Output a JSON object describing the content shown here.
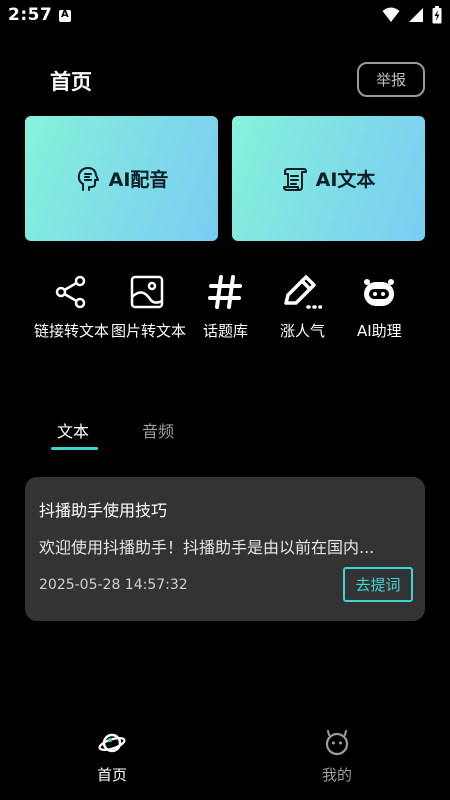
{
  "status": {
    "time": "2:57"
  },
  "header": {
    "title": "首页",
    "report_label": "举报"
  },
  "cards": {
    "left": {
      "label": "AI配音",
      "icon": "ai-voice-icon"
    },
    "right": {
      "label": "AI文本",
      "icon": "scroll-icon"
    }
  },
  "tools": [
    {
      "label": "链接转文本",
      "icon": "share-icon"
    },
    {
      "label": "图片转文本",
      "icon": "image-icon"
    },
    {
      "label": "话题库",
      "icon": "hashtag-icon"
    },
    {
      "label": "涨人气",
      "icon": "pencil-icon"
    },
    {
      "label": "AI助理",
      "icon": "robot-icon"
    }
  ],
  "tabs": [
    {
      "label": "文本",
      "active": true
    },
    {
      "label": "音频",
      "active": false
    }
  ],
  "article": {
    "title": "抖播助手使用技巧",
    "excerpt": "欢迎使用抖播助手！抖播助手是由以前在国内...",
    "date": "2025-05-28 14:57:32",
    "action_label": "去提词"
  },
  "bottom_nav": {
    "home": {
      "label": "首页",
      "icon": "planet-icon"
    },
    "me": {
      "label": "我的",
      "icon": "face-icon"
    }
  },
  "colors": {
    "accent": "#3fd4d0",
    "card_gradient_start": "#86f3da",
    "card_gradient_end": "#79cdf2"
  }
}
